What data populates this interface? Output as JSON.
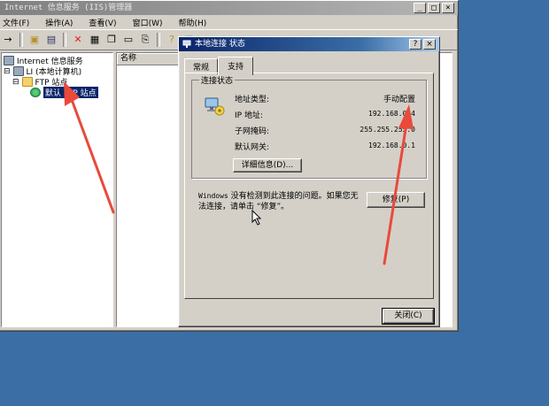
{
  "main_window": {
    "title": "Internet 信息服务 (IIS)管理器",
    "menus": [
      "文件(F)",
      "操作(A)",
      "查看(V)",
      "窗口(W)",
      "帮助(H)"
    ],
    "tree": {
      "root": "Internet 信息服务",
      "computer": "LI (本地计算机)",
      "ftp_folder": "FTP 站点",
      "ftp_site": "默认 FTP 站点"
    },
    "list_header": "名称"
  },
  "dialog": {
    "title": "本地连接 状态",
    "tabs": [
      "常规",
      "支持"
    ],
    "active_tab": "支持",
    "group_title": "连接状态",
    "fields": [
      {
        "label": "地址类型:",
        "value": "手动配置"
      },
      {
        "label": "IP 地址:",
        "value": "192.168.0.4"
      },
      {
        "label": "子网掩码:",
        "value": "255.255.255.0"
      },
      {
        "label": "默认网关:",
        "value": "192.168.0.1"
      }
    ],
    "details_button": "详细信息(D)...",
    "message": "Windows 没有检测到此连接的问题。如果您无法连接，请单击 “修复”。",
    "message_prefix": "Windows",
    "message_rest": " 没有检测到此连接的问题。如果您无法连接，请单击 “修复”。",
    "repair_button": "修复(P)",
    "close_button": "关闭(C)"
  },
  "colors": {
    "desktop": "#3a6ea5",
    "active_title": "#0a246a",
    "annotation_arrow": "#e84a3c"
  }
}
